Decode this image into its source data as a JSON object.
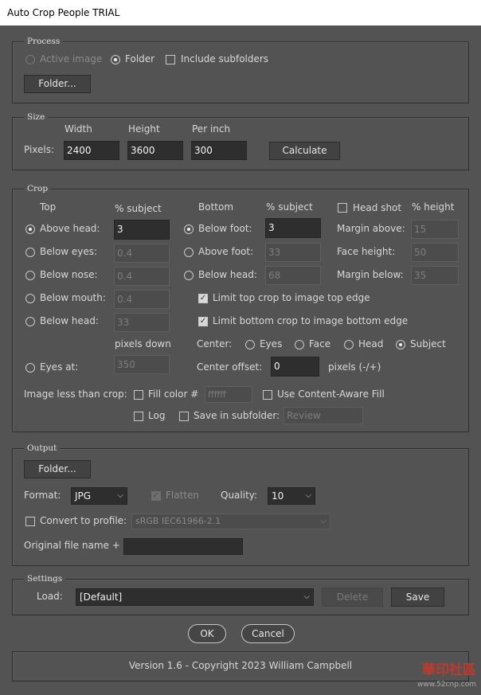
{
  "window": {
    "title": "Auto Crop People TRIAL"
  },
  "process": {
    "legend": "Process",
    "active_image": "Active image",
    "folder": "Folder",
    "include_subfolders": "Include subfolders",
    "folder_button": "Folder..."
  },
  "size": {
    "legend": "Size",
    "width_label": "Width",
    "height_label": "Height",
    "per_inch_label": "Per inch",
    "pixels_label": "Pixels:",
    "width": "2400",
    "height": "3600",
    "per_inch": "300",
    "calculate": "Calculate"
  },
  "crop": {
    "legend": "Crop",
    "top_label": "Top",
    "pct_subject": "% subject",
    "bottom_label": "Bottom",
    "pct_subject_2": "% subject",
    "head_shot": "Head shot",
    "pct_height": "% height",
    "top_options": [
      {
        "label": "Above head:",
        "value": "3"
      },
      {
        "label": "Below eyes:",
        "value": "0.4"
      },
      {
        "label": "Below nose:",
        "value": "0.4"
      },
      {
        "label": "Below mouth:",
        "value": "0.4"
      },
      {
        "label": "Below head:",
        "value": "33"
      }
    ],
    "bottom_options": [
      {
        "label": "Below foot:",
        "value": "3"
      },
      {
        "label": "Above foot:",
        "value": "33"
      },
      {
        "label": "Below head:",
        "value": "68"
      }
    ],
    "head_options": [
      {
        "label": "Margin above:",
        "value": "15"
      },
      {
        "label": "Face height:",
        "value": "50"
      },
      {
        "label": "Margin below:",
        "value": "35"
      }
    ],
    "limit_top": "Limit top crop to image top edge",
    "limit_bottom": "Limit bottom crop to image bottom edge",
    "pixels_down": "pixels down",
    "eyes_at": "Eyes at:",
    "eyes_at_value": "350",
    "center_label": "Center:",
    "center_options": [
      "Eyes",
      "Face",
      "Head",
      "Subject"
    ],
    "center_offset_label": "Center offset:",
    "center_offset": "0",
    "pixels_pm": "pixels (-/+)",
    "image_less": "Image less than crop:",
    "fill_color": "Fill color #",
    "fill_value": "ffffff",
    "content_aware": "Use Content-Aware Fill",
    "log": "Log",
    "save_subfolder": "Save in subfolder:",
    "subfolder_value": "Review"
  },
  "output": {
    "legend": "Output",
    "folder_button": "Folder...",
    "format_label": "Format:",
    "format": "JPG",
    "flatten": "Flatten",
    "quality_label": "Quality:",
    "quality": "10",
    "convert_profile": "Convert to profile:",
    "profile": "sRGB IEC61966-2.1",
    "original_name": "Original file name +",
    "original_name_value": ""
  },
  "settings": {
    "legend": "Settings",
    "load_label": "Load:",
    "load_value": "[Default]",
    "delete": "Delete",
    "save": "Save"
  },
  "dialog": {
    "ok": "OK",
    "cancel": "Cancel"
  },
  "footer": {
    "version": "Version 1.6 - Copyright 2023 William Campbell"
  },
  "watermark": {
    "text": "華印社區",
    "url": "www.52cnp.com"
  }
}
